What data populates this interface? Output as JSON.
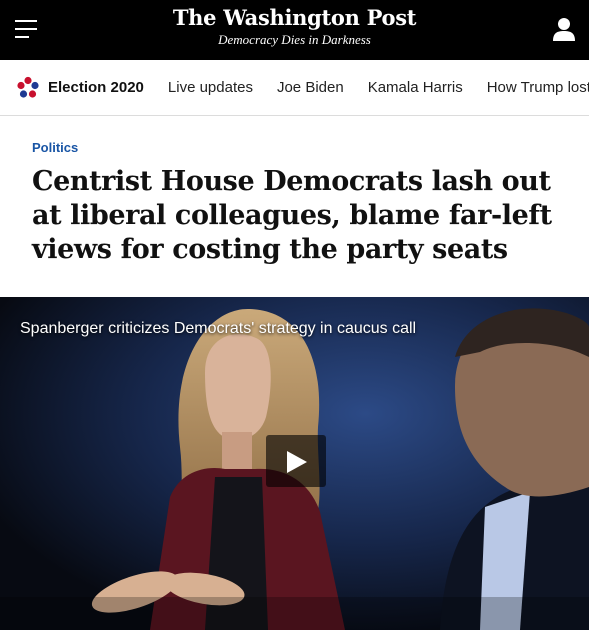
{
  "header": {
    "logo_text": "The Washington Post",
    "tagline": "Democracy Dies in Darkness",
    "menu_icon": "hamburger-menu-icon",
    "user_icon": "user-account-icon"
  },
  "nav": {
    "election_logo_icon": "election-star-logo-icon",
    "election_label": "Election 2020",
    "links": [
      "Live updates",
      "Joe Biden",
      "Kamala Harris",
      "How Trump lost"
    ]
  },
  "article": {
    "kicker": "Politics",
    "headline": "Centrist House Democrats lash out at liberal colleagues, blame far-left views for costing the party seats"
  },
  "video": {
    "caption": "Spanberger criticizes Democrats' strategy in caucus call",
    "play_icon": "play-icon"
  },
  "colors": {
    "header_bg": "#000000",
    "kicker": "#1955a5",
    "headline": "#111111"
  }
}
